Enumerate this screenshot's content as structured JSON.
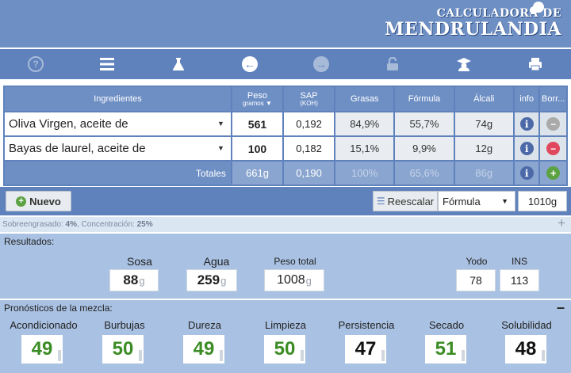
{
  "header": {
    "logo_line1": "CALCULADORA DE",
    "logo_line2": "MENDRULANDIA"
  },
  "toolbar": {
    "icons": [
      "help-icon",
      "menu-icon",
      "flask-icon",
      "back-arrow-icon",
      "forward-arrow-icon",
      "unlock-icon",
      "graduate-icon",
      "print-icon"
    ],
    "help_glyph": "?"
  },
  "table": {
    "headers": {
      "ingredients": "Ingredientes",
      "weight": "Peso",
      "weight_sub": "gramos ▼",
      "sap": "SAP",
      "sap_sub": "(KOH)",
      "fats": "Grasas",
      "formula": "Fórmula",
      "alkali": "Álcali",
      "info": "info",
      "delete": "Borr..."
    },
    "rows": [
      {
        "ingredient": "Oliva Virgen, aceite de",
        "weight": "561",
        "sap": "0,192",
        "fats": "84,9%",
        "formula": "55,7%",
        "alkali": "74g"
      },
      {
        "ingredient": "Bayas de laurel, aceite de",
        "weight": "100",
        "sap": "0,182",
        "fats": "15,1%",
        "formula": "9,9%",
        "alkali": "12g"
      }
    ],
    "totals": {
      "label": "Totales",
      "weight": "661g",
      "sap": "0,190",
      "fats": "100%",
      "formula": "65,6%",
      "alkali": "86g"
    }
  },
  "actions": {
    "new_label": "Nuevo",
    "rescale_label": "Reescalar",
    "rescale_mode": "Fórmula",
    "rescale_amount": "1010g"
  },
  "summary": {
    "superfat_label": "Sobreengrasado:",
    "superfat_value": "4%",
    "concentration_label": "Concentración:",
    "concentration_value": "25%"
  },
  "results": {
    "title": "Resultados:",
    "soda_label": "Sosa",
    "soda_value": "88",
    "soda_unit": "g",
    "water_label": "Agua",
    "water_value": "259",
    "water_unit": "g",
    "total_label": "Peso total",
    "total_value": "1008",
    "total_unit": "g",
    "iodine_label": "Yodo",
    "iodine_value": "78",
    "ins_label": "INS",
    "ins_value": "113"
  },
  "forecast": {
    "title": "Pronósticos de la mezcla:",
    "items": [
      {
        "label": "Acondicionado",
        "value": "49",
        "color": "#3b8c24"
      },
      {
        "label": "Burbujas",
        "value": "50",
        "color": "#3b8c24"
      },
      {
        "label": "Dureza",
        "value": "49",
        "color": "#3b8c24"
      },
      {
        "label": "Limpieza",
        "value": "50",
        "color": "#3b8c24"
      },
      {
        "label": "Persistencia",
        "value": "47",
        "color": "#111111"
      },
      {
        "label": "Secado",
        "value": "51",
        "color": "#3b8c24"
      },
      {
        "label": "Solubilidad",
        "value": "48",
        "color": "#111111"
      }
    ]
  }
}
